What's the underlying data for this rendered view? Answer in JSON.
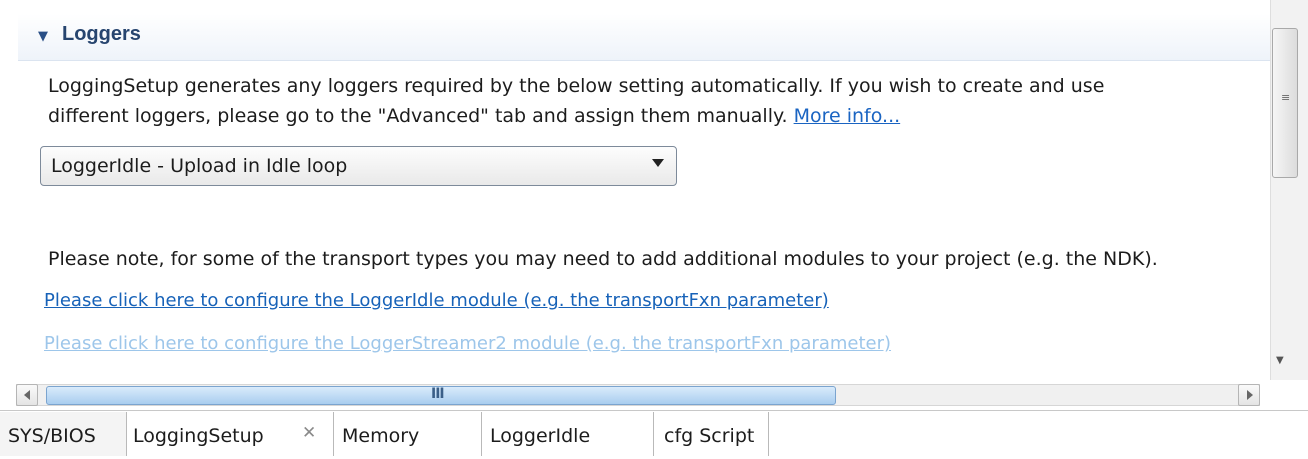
{
  "section": {
    "toggle_glyph": "▼",
    "title": "Loggers"
  },
  "description": {
    "line1": "LoggingSetup generates any loggers required by the below setting automatically. If you wish to create and use",
    "line2": "different loggers, please go to the \"Advanced\" tab and assign them manually.",
    "more_info_link": "More info..."
  },
  "logger_select": {
    "value": "LoggerIdle - Upload in Idle loop"
  },
  "note": "Please note, for some of the transport types you may need to add additional modules to your project (e.g. the NDK).",
  "links": {
    "configure_idle": "Please click here to configure the LoggerIdle module (e.g. the transportFxn parameter)",
    "configure_streamer2": "Please click here to configure the LoggerStreamer2 module (e.g. the transportFxn parameter)"
  },
  "scrollbars": {
    "vertical_grip": "≡",
    "horizontal_grip": "III"
  },
  "tabs": {
    "sysbios": "SYS/BIOS",
    "loggingsetup": "LoggingSetup",
    "loggingsetup_close": "✕",
    "memory": "Memory",
    "loggeridle": "LoggerIdle",
    "cfgscript": "cfg Script"
  },
  "colors": {
    "link_active": "#1762b8",
    "link_disabled": "#9dc6ea",
    "section_title": "#27456f",
    "scroll_thumb": "#a9cdef"
  }
}
